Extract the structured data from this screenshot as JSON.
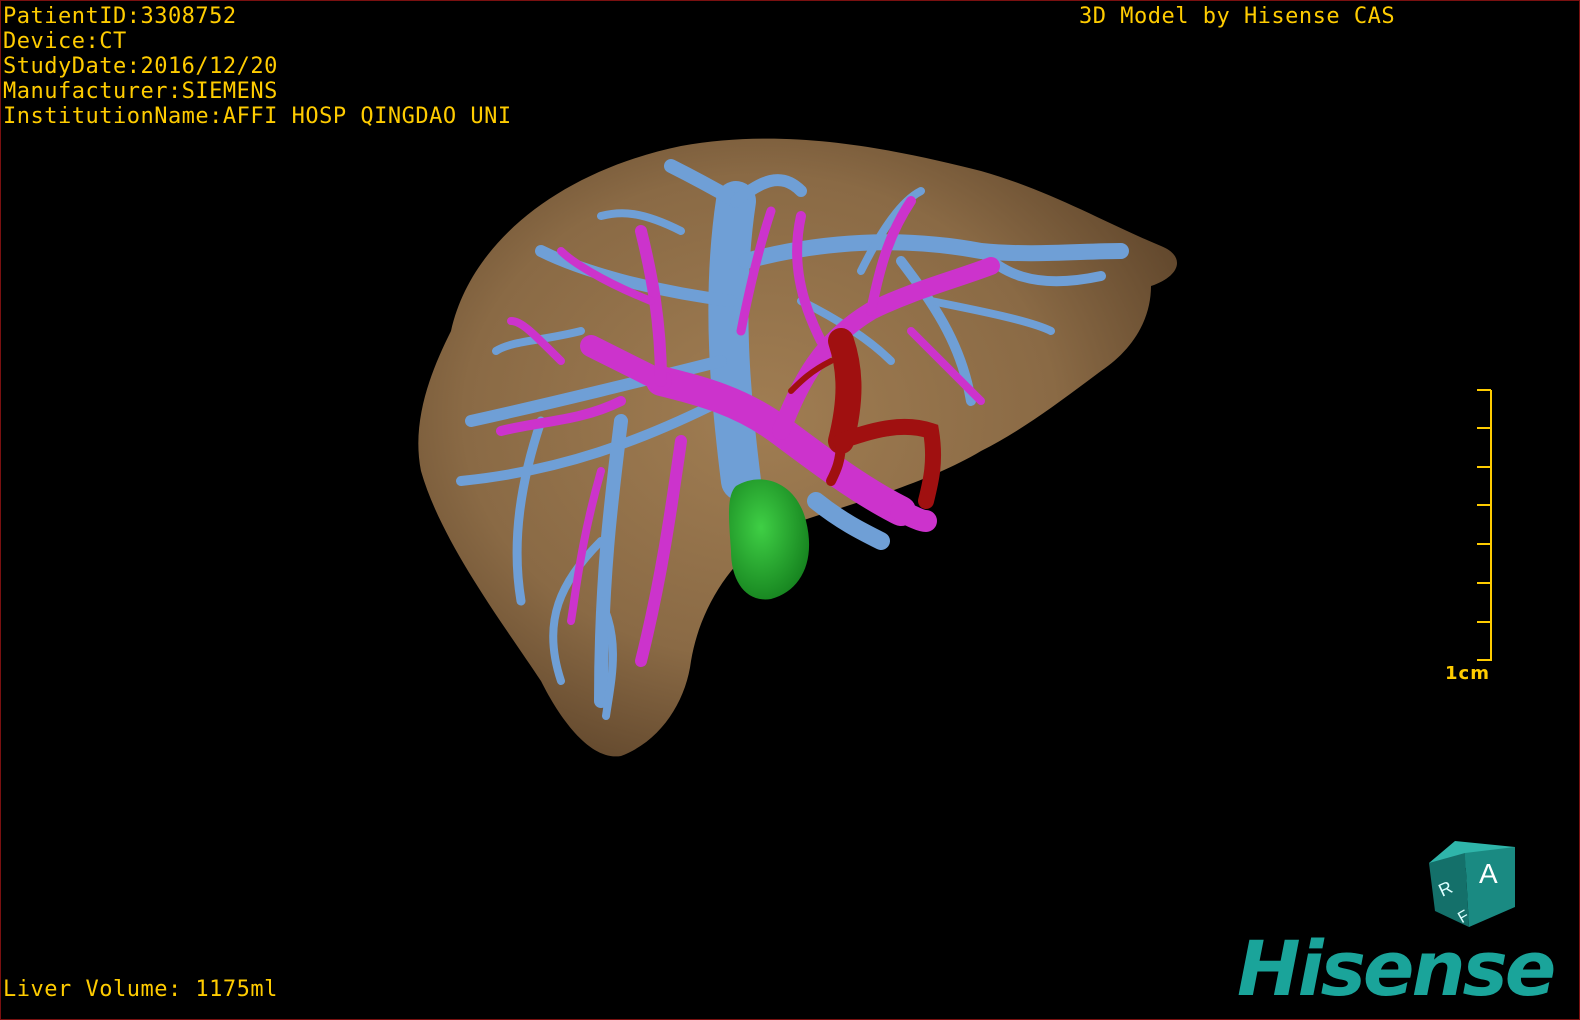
{
  "header_info": {
    "patient_id": "PatientID:3308752",
    "device": "Device:CT",
    "study_date": "StudyDate:2016/12/20",
    "manufacturer": "Manufacturer:SIEMENS",
    "institution": "InstitutionName:AFFI HOSP QINGDAO UNI"
  },
  "credit": "3D Model by Hisense CAS",
  "footer": {
    "liver_volume": "Liver Volume: 1175ml"
  },
  "scale_bar": {
    "label": "1cm",
    "tick_count": 8
  },
  "orientation_cube": {
    "face_top": "A",
    "face_left": "R",
    "face_bottom": "F"
  },
  "brand": {
    "logo_text": "Hisense"
  },
  "colors": {
    "overlay_text": "#ffcc00",
    "liver": "#8a6a45",
    "hepatic_vein": "#6f9fd6",
    "portal_vein": "#cc33cc",
    "artery": "#a01010",
    "gallbladder": "#1f9a2a",
    "brand": "#1aa49a",
    "cube": "#1a8a82"
  }
}
